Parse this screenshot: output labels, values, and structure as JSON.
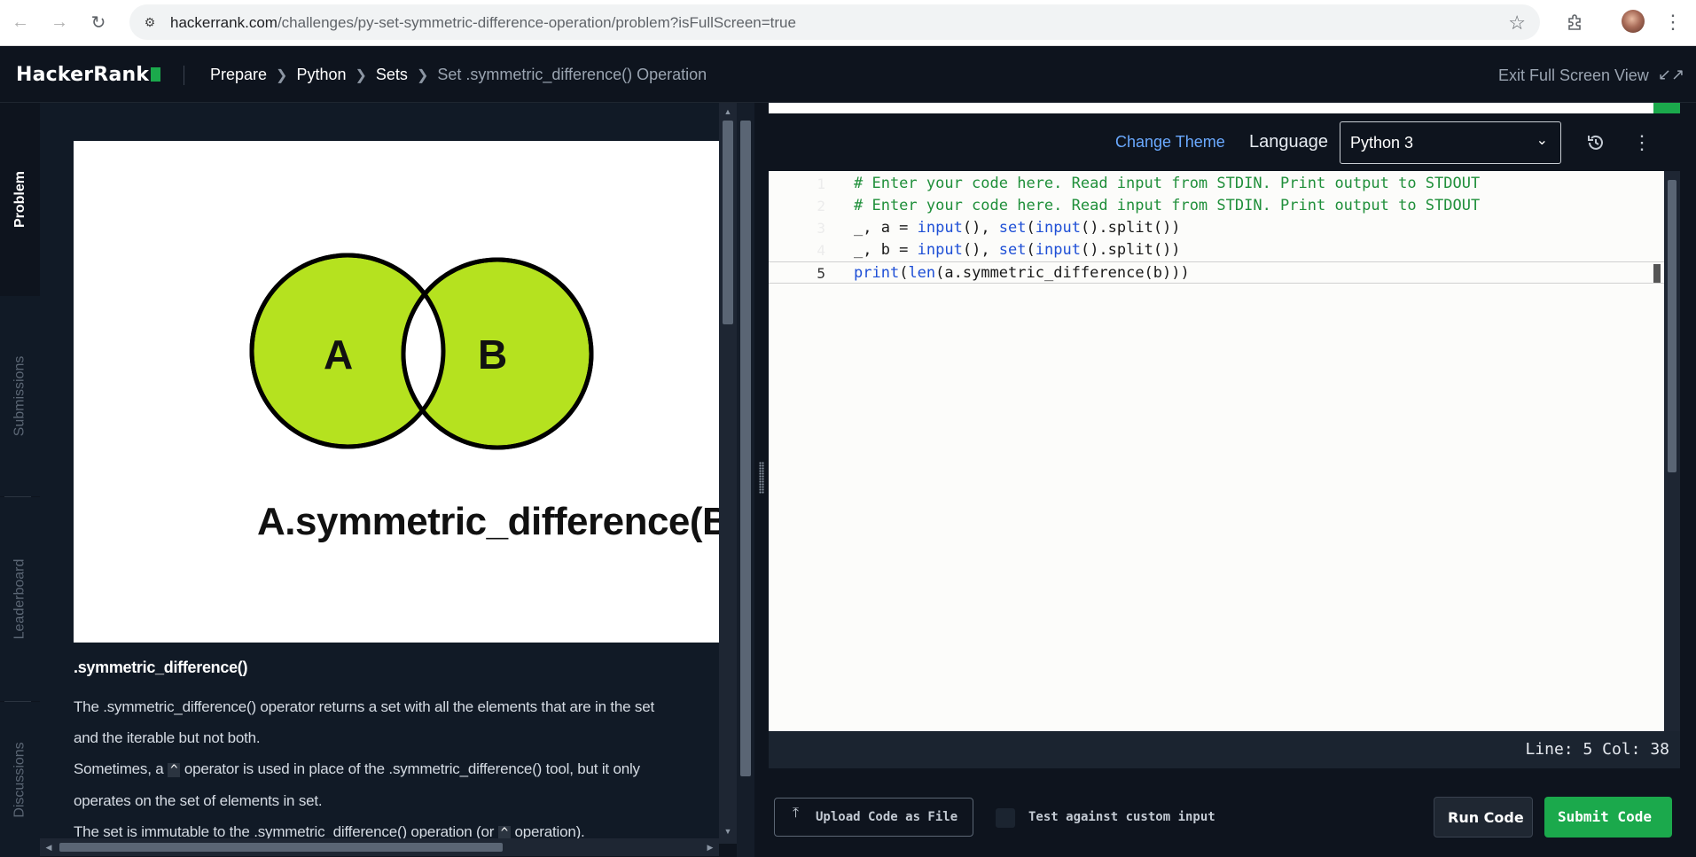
{
  "browser": {
    "url_host": "hackerrank.com",
    "url_path": "/challenges/py-set-symmetric-difference-operation/problem?isFullScreen=true"
  },
  "header": {
    "logo": "HackerRank",
    "breadcrumbs": [
      "Prepare",
      "Python",
      "Sets",
      "Set .symmetric_difference() Operation"
    ],
    "exit_fullscreen": "Exit Full Screen View"
  },
  "side_tabs": [
    "Problem",
    "Submissions",
    "Leaderboard",
    "Discussions"
  ],
  "problem": {
    "diagram": {
      "label_a": "A",
      "label_b": "B",
      "caption": "A.symmetric_difference(B) or",
      "fill_color": "#b5e21f"
    },
    "section_title": ".symmetric_difference()",
    "para1_line1": "The .symmetric_difference() operator returns a set with all the elements that are in the set",
    "para1_line2": "and the iterable but not both.",
    "para2_before": "Sometimes, a ",
    "para2_code": "^",
    "para2_after": " operator is used in place of the .symmetric_difference() tool, but it only",
    "para2_line2": "operates on the set of elements in set.",
    "para3_before": "The set is immutable to the .symmetric_difference() operation (or ",
    "para3_code": "^",
    "para3_after": " operation)."
  },
  "editor": {
    "change_theme": "Change Theme",
    "language_label": "Language",
    "language_value": "Python 3",
    "line_numbers": [
      "1",
      "2",
      "3",
      "4",
      "5"
    ],
    "lines": [
      [
        {
          "t": "# Enter your code here. Read input from STDIN. Print output to STDOUT",
          "c": "cmt"
        }
      ],
      [
        {
          "t": "# Enter your code here. Read input from STDIN. Print output to STDOUT",
          "c": "cmt"
        }
      ],
      [
        {
          "t": "_, a = ",
          "c": ""
        },
        {
          "t": "input",
          "c": "kw"
        },
        {
          "t": "(), ",
          "c": ""
        },
        {
          "t": "set",
          "c": "kw"
        },
        {
          "t": "(",
          "c": ""
        },
        {
          "t": "input",
          "c": "kw"
        },
        {
          "t": "().split())",
          "c": ""
        }
      ],
      [
        {
          "t": "_, b = ",
          "c": ""
        },
        {
          "t": "input",
          "c": "kw"
        },
        {
          "t": "(), ",
          "c": ""
        },
        {
          "t": "set",
          "c": "kw"
        },
        {
          "t": "(",
          "c": ""
        },
        {
          "t": "input",
          "c": "kw"
        },
        {
          "t": "().split())",
          "c": ""
        }
      ],
      [
        {
          "t": "print",
          "c": "kw"
        },
        {
          "t": "(",
          "c": ""
        },
        {
          "t": "len",
          "c": "kw"
        },
        {
          "t": "(a.symmetric_difference(b)))",
          "c": ""
        }
      ]
    ],
    "active_line": 5,
    "status": "Line: 5 Col: 38"
  },
  "footer": {
    "upload": "Upload Code as File",
    "custom_input": "Test against custom input",
    "run": "Run Code",
    "submit": "Submit Code"
  },
  "colors": {
    "accent_green": "#1ba94c",
    "link_blue": "#6aa9ff"
  }
}
